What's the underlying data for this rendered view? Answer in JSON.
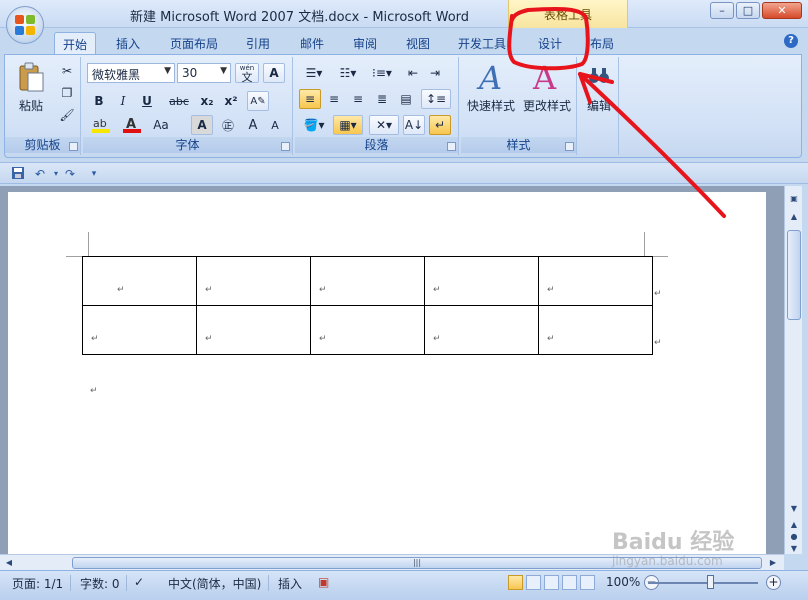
{
  "window": {
    "title": "新建 Microsoft Word 2007 文档.docx - Microsoft Word",
    "contextual_group": "表格工具",
    "controls": {
      "minimize": "–",
      "maximize": "□",
      "close": "✕"
    }
  },
  "tabs": [
    {
      "label": "开始",
      "active": true
    },
    {
      "label": "插入"
    },
    {
      "label": "页面布局"
    },
    {
      "label": "引用"
    },
    {
      "label": "邮件"
    },
    {
      "label": "审阅"
    },
    {
      "label": "视图"
    },
    {
      "label": "开发工具"
    },
    {
      "label": "设计",
      "contextual": true
    },
    {
      "label": "布局",
      "contextual": true
    }
  ],
  "ribbon": {
    "clipboard": {
      "label": "剪贴板",
      "paste": "粘贴"
    },
    "font": {
      "label": "字体",
      "font_name": "微软雅黑",
      "font_size": "30",
      "bold": "B",
      "italic": "I",
      "underline": "U",
      "strike": "abc",
      "subscript": "x₂",
      "superscript": "x²",
      "font_color": "A",
      "change_case": "Aa",
      "grow": "A",
      "shrink": "A",
      "phonetic": "wén",
      "phonetic_char": "文"
    },
    "paragraph": {
      "label": "段落"
    },
    "styles": {
      "label": "样式",
      "quick_styles": "快速样式",
      "change_styles": "更改样式"
    },
    "editing": {
      "label": "编辑"
    }
  },
  "document": {
    "rows": 2,
    "cols": 5,
    "paragraph_mark": "↵"
  },
  "statusbar": {
    "page": "页面: 1/1",
    "words": "字数: 0",
    "language": "中文(简体，中国)",
    "insert_mode": "插入",
    "zoom": "100%"
  },
  "watermark": {
    "line1": "Baidu 经验",
    "line2": "jingyan.baidu.com"
  },
  "colors": {
    "annotation": "#e8141c",
    "highlight_yellow": "#f7e600",
    "font_red": "#e01010"
  }
}
